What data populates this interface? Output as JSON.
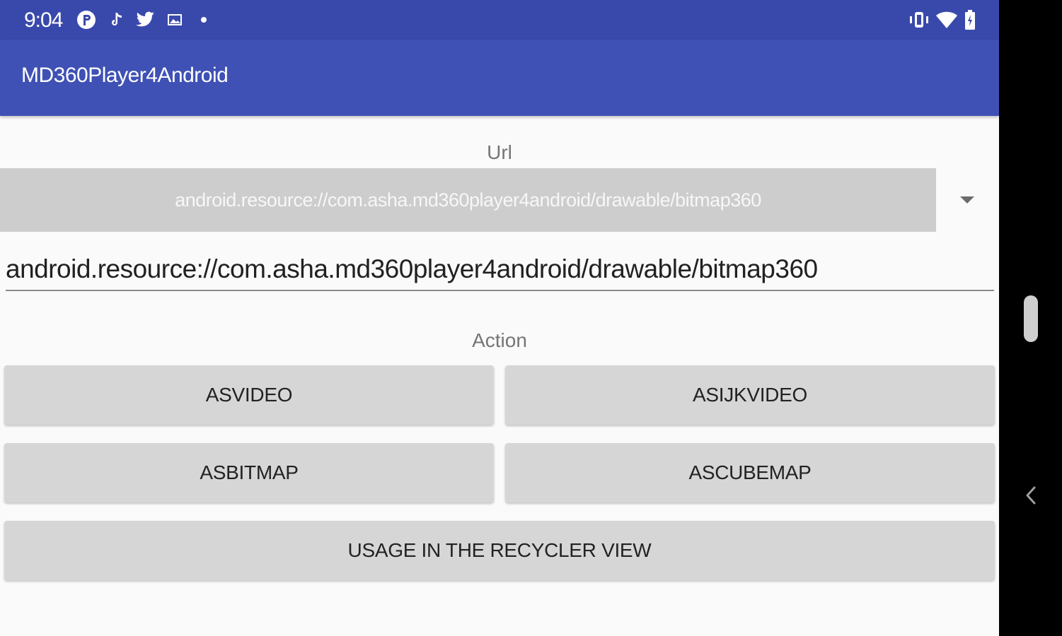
{
  "status_bar": {
    "time": "9:04",
    "notification_icons": [
      "pinterest-icon",
      "tiktok-icon",
      "twitter-icon",
      "gallery-icon",
      "dot-icon"
    ],
    "system_icons": [
      "vibrate-icon",
      "wifi-icon",
      "battery-icon"
    ]
  },
  "app_bar": {
    "title": "MD360Player4Android"
  },
  "url_section": {
    "label": "Url",
    "spinner_selected": "android.resource://com.asha.md360player4android/drawable/bitmap360",
    "input_value": "android.resource://com.asha.md360player4android/drawable/bitmap360"
  },
  "action_section": {
    "label": "Action",
    "buttons": {
      "asvideo": "ASVIDEO",
      "asijkvideo": "ASIJKVIDEO",
      "asbitmap": "ASBITMAP",
      "ascubemap": "ASCUBEMAP",
      "recycler": "USAGE IN THE RECYCLER VIEW"
    }
  },
  "colors": {
    "status_bar": "#3949ab",
    "app_bar": "#3f51b5",
    "background": "#fafafa",
    "button": "#d6d6d6"
  }
}
